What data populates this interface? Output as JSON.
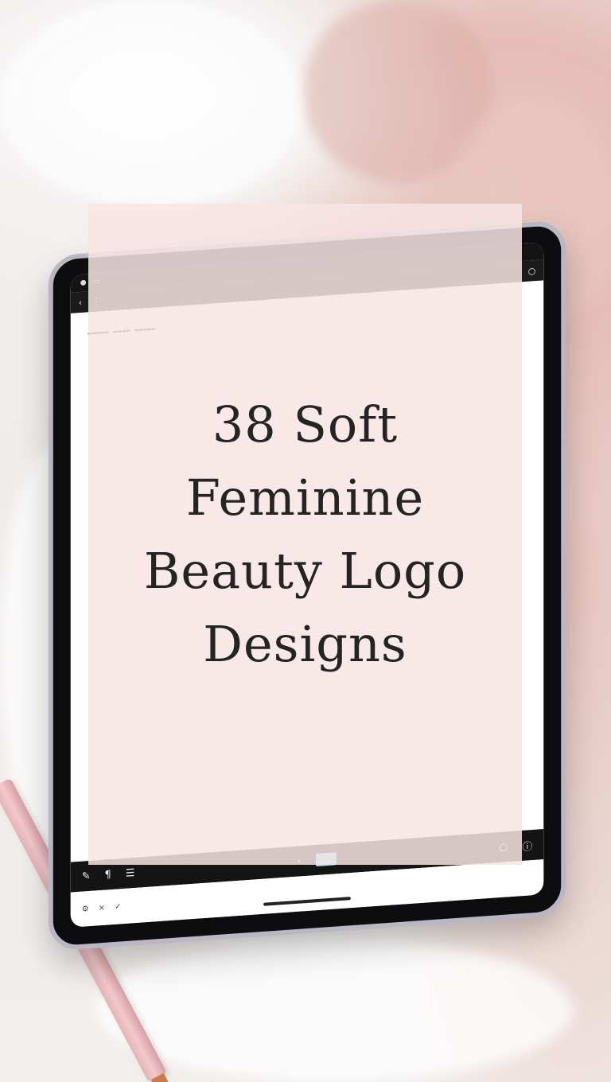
{
  "overlay": {
    "title_lines": [
      "38 Soft",
      "Feminine",
      "Beauty Logo",
      "Designs"
    ]
  },
  "colors": {
    "overlay": "#f8e4e4",
    "title_text": "#242424",
    "blanket_pink": "#e4bdb6",
    "sheet_white": "#f3f1f0",
    "tablet_frame": "#0d0d0f",
    "pencil": "#f2c9cd",
    "toolbar_swatch": "#8fe3f6"
  },
  "icons": {
    "back": "chevron-left-icon",
    "more": "more-vertical-icon",
    "undo": "undo-icon",
    "redo": "redo-icon",
    "pen": "pen-icon",
    "text": "text-icon",
    "circle": "circle-icon",
    "info": "info-icon"
  }
}
